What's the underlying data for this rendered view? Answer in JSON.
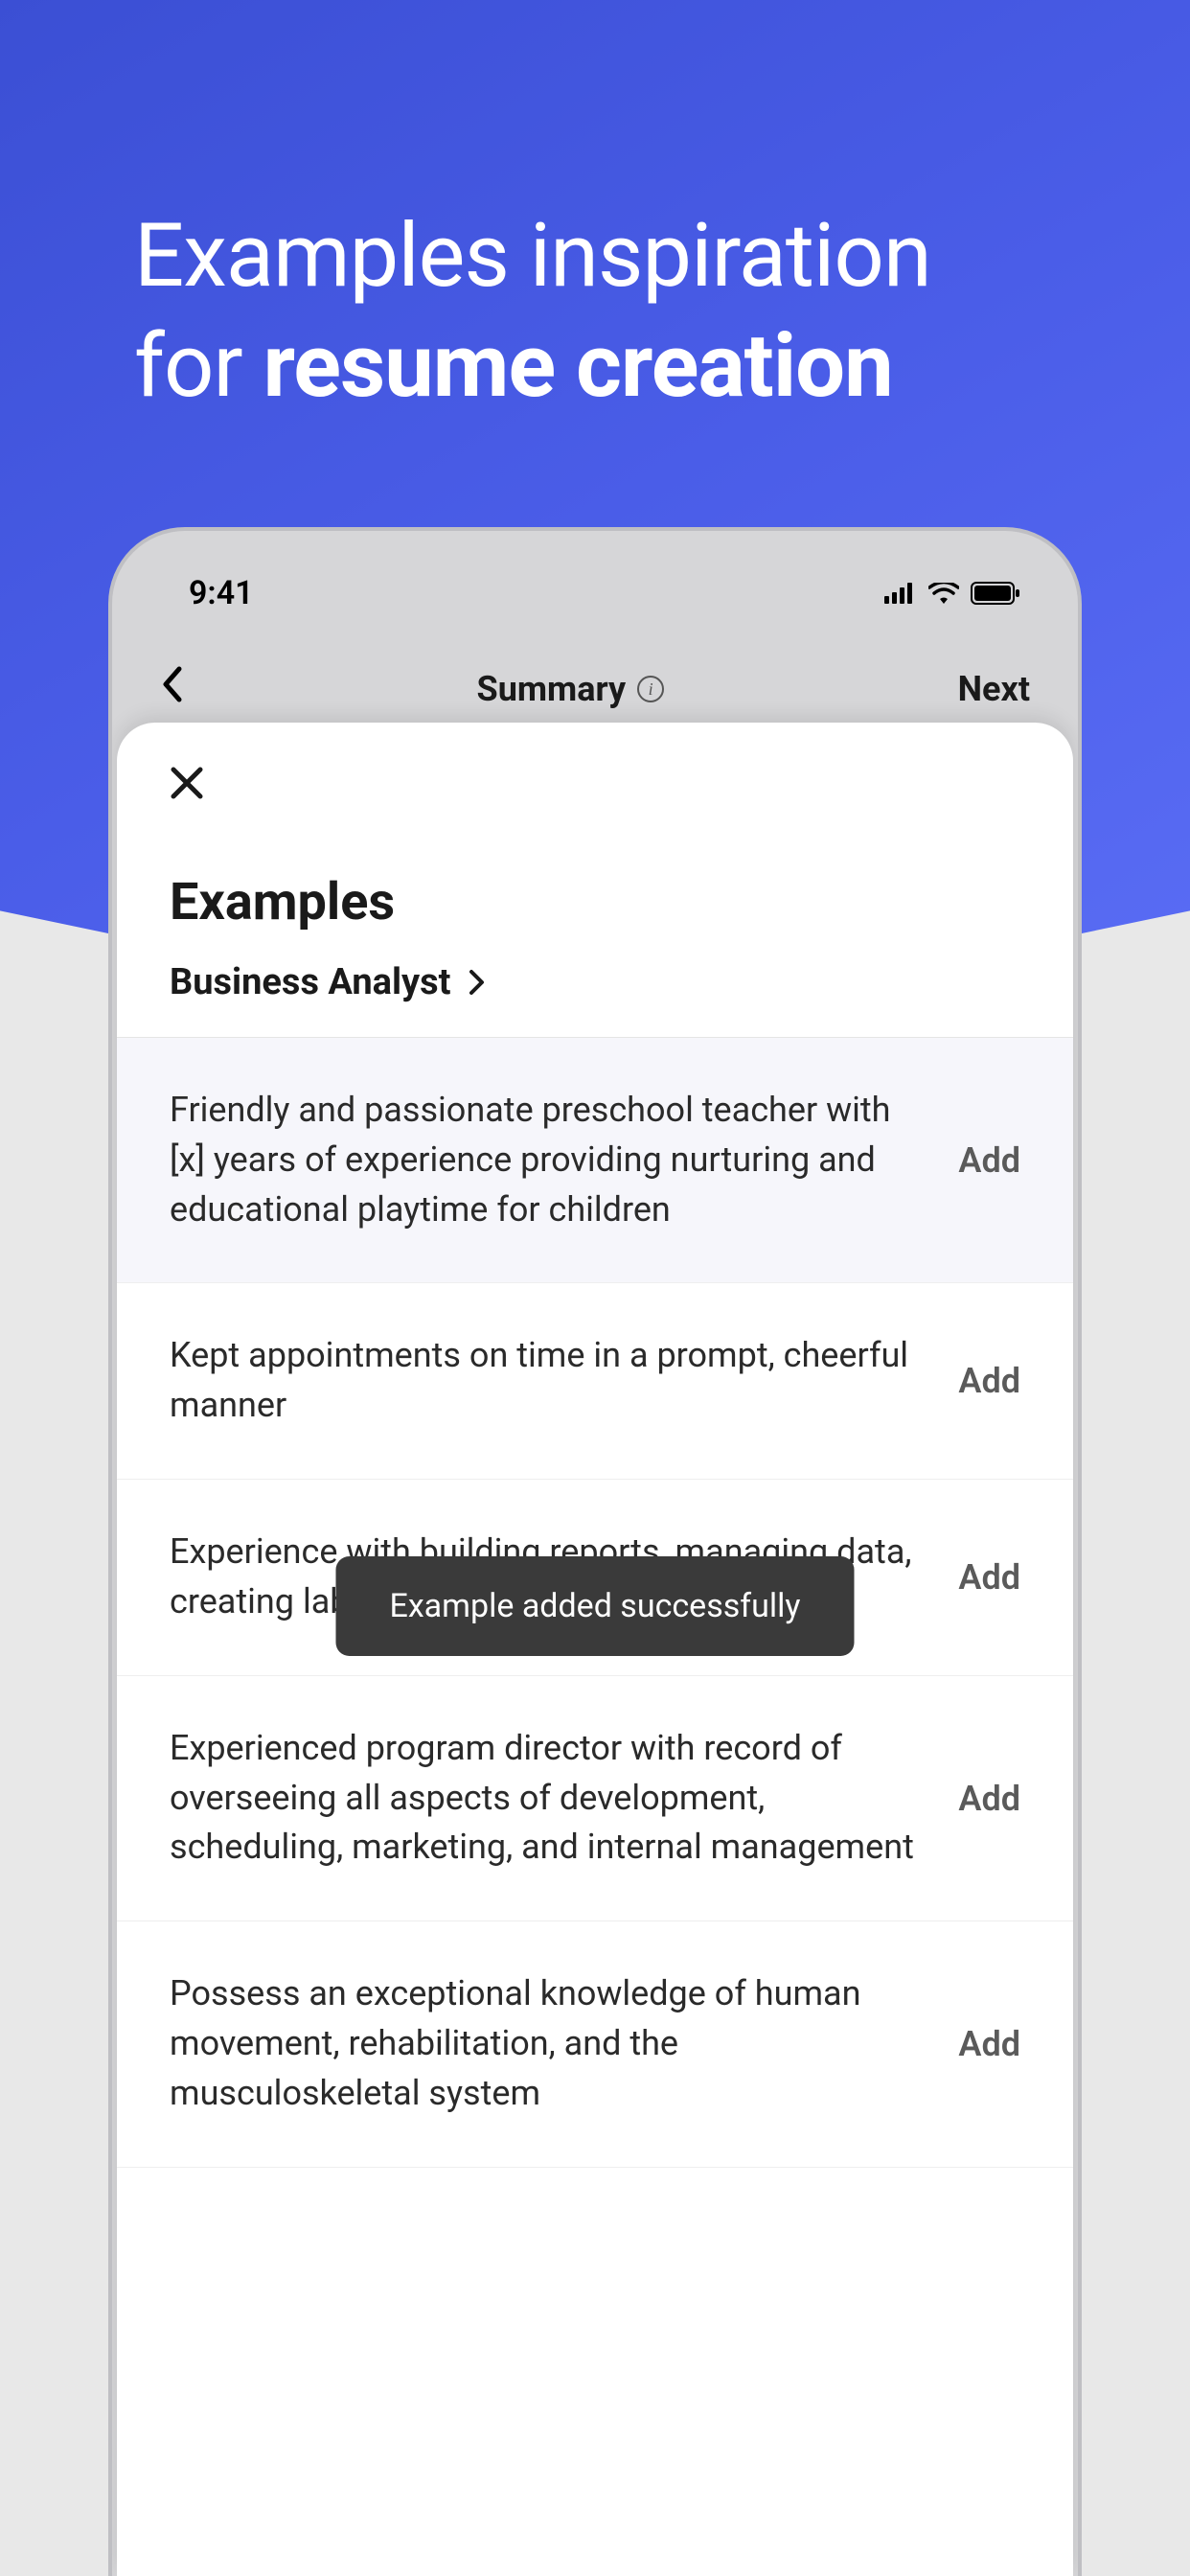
{
  "hero": {
    "line1": "Examples inspiration",
    "line2_prefix": "for ",
    "line2_bold": "resume creation"
  },
  "status_bar": {
    "time": "9:41"
  },
  "nav": {
    "title": "Summary",
    "next": "Next"
  },
  "sheet": {
    "title": "Examples",
    "category": "Business Analyst",
    "close_label": "Close"
  },
  "toast": {
    "message": "Example added successfully"
  },
  "examples": [
    {
      "text": "Friendly and passionate preschool teacher with [x] years of experience providing nurturing and educational playtime for children",
      "action": "Add",
      "highlighted": true
    },
    {
      "text": "Kept appointments on time in a prompt, cheerful manner",
      "action": "Add",
      "highlighted": false
    },
    {
      "text": "Experience with building reports, managing data, creating labels, and making calculations",
      "action": "Add",
      "highlighted": false
    },
    {
      "text": "Experienced program director with record of overseeing all aspects of development, scheduling, marketing, and internal management",
      "action": "Add",
      "highlighted": false
    },
    {
      "text": "Possess an exceptional knowledge of human movement, rehabilitation, and the musculoskeletal system",
      "action": "Add",
      "highlighted": false
    }
  ]
}
